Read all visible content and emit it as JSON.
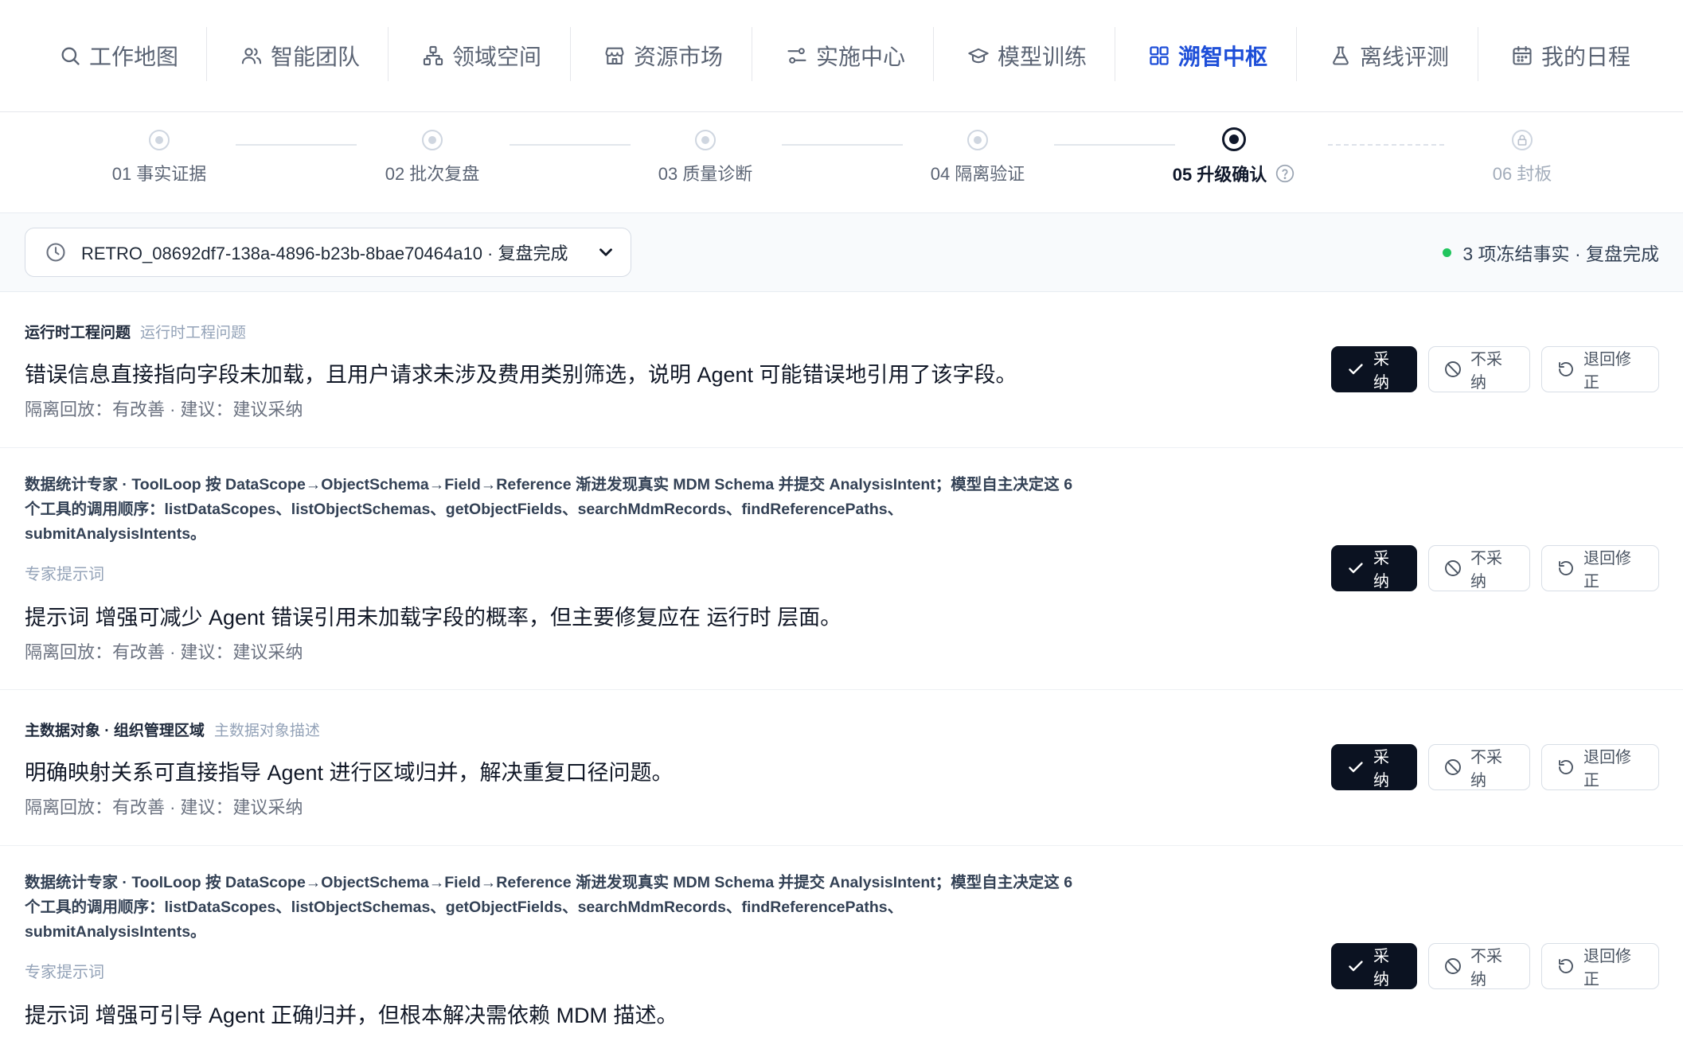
{
  "nav": {
    "items": [
      {
        "label": "工作地图",
        "icon": "search-icon"
      },
      {
        "label": "智能团队",
        "icon": "team-icon"
      },
      {
        "label": "领域空间",
        "icon": "hierarchy-icon"
      },
      {
        "label": "资源市场",
        "icon": "store-icon"
      },
      {
        "label": "实施中心",
        "icon": "sliders-icon"
      },
      {
        "label": "模型训练",
        "icon": "graduation-cap-icon"
      },
      {
        "label": "溯智中枢",
        "icon": "grid-icon",
        "active": true
      },
      {
        "label": "离线评测",
        "icon": "flask-icon"
      },
      {
        "label": "我的日程",
        "icon": "calendar-icon"
      }
    ],
    "active_color": "#1d4ed8"
  },
  "stepper": {
    "steps": [
      {
        "label": "01 事实证据",
        "state": "done"
      },
      {
        "label": "02 批次复盘",
        "state": "done"
      },
      {
        "label": "03 质量诊断",
        "state": "done"
      },
      {
        "label": "04 隔离验证",
        "state": "done"
      },
      {
        "label": "05 升级确认",
        "state": "current"
      },
      {
        "label": "06 封板",
        "state": "locked"
      }
    ]
  },
  "retro": {
    "selected": "RETRO_08692df7-138a-4896-b23b-8bae70464a10 · 复盘完成",
    "status_text": "3 项冻结事实 · 复盘完成",
    "status_color": "#22c55e"
  },
  "actions": {
    "adopt": "采纳",
    "reject": "不采纳",
    "return": "退回修正"
  },
  "items": [
    {
      "type": "fact",
      "category": "运行时工程问题",
      "category_sub": "运行时工程问题",
      "headline": "错误信息直接指向字段未加载，且用户请求未涉及费用类别筛选，说明 Agent 可能错误地引用了该字段。",
      "meta": "隔离回放：有改善 · 建议：建议采纳"
    },
    {
      "type": "prompt",
      "prompt": "数据统计专家 · ToolLoop 按 DataScope→ObjectSchema→Field→Reference 渐进发现真实 MDM Schema 并提交 AnalysisIntent；模型自主决定这 6 个工具的调用顺序：listDataScopes、listObjectSchemas、getObjectFields、searchMdmRecords、findReferencePaths、submitAnalysisIntents。",
      "tag": "专家提示词",
      "headline": "提示词 增强可减少 Agent 错误引用未加载字段的概率，但主要修复应在 运行时 层面。",
      "meta": "隔离回放：有改善 · 建议：建议采纳"
    },
    {
      "type": "fact",
      "category": "主数据对象 · 组织管理区域",
      "category_sub": "主数据对象描述",
      "headline": "明确映射关系可直接指导 Agent 进行区域归并，解决重复口径问题。",
      "meta": "隔离回放：有改善 · 建议：建议采纳"
    },
    {
      "type": "prompt",
      "prompt": "数据统计专家 · ToolLoop 按 DataScope→ObjectSchema→Field→Reference 渐进发现真实 MDM Schema 并提交 AnalysisIntent；模型自主决定这 6 个工具的调用顺序：listDataScopes、listObjectSchemas、getObjectFields、searchMdmRecords、findReferencePaths、submitAnalysisIntents。",
      "tag": "专家提示词",
      "headline": "提示词 增强可引导 Agent 正确归并，但根本解决需依赖 MDM 描述。",
      "meta": "隔离回放：有改善 · 建议：建议采纳"
    }
  ]
}
